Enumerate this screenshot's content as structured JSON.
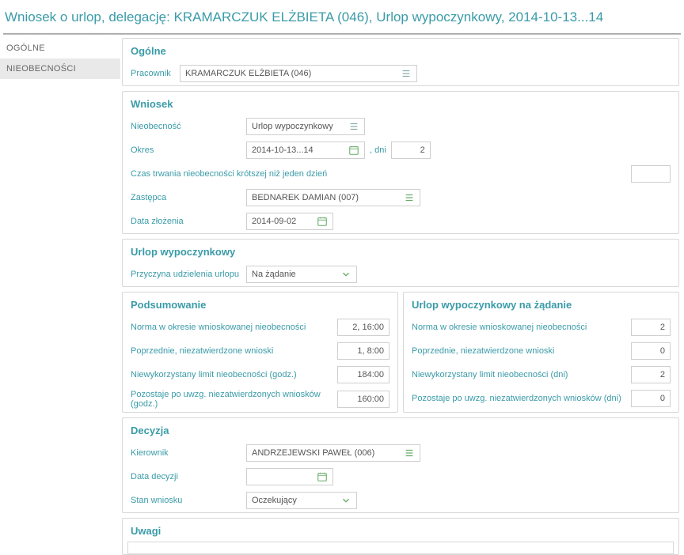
{
  "title": "Wniosek o urlop, delegację: KRAMARCZUK ELŻBIETA (046), Urlop wypoczynkowy, 2014-10-13...14",
  "sidebar": {
    "items": [
      {
        "label": "OGÓLNE"
      },
      {
        "label": "NIEOBECNOŚCI"
      }
    ]
  },
  "general": {
    "heading": "Ogólne",
    "emp_label": "Pracownik",
    "emp_value": "KRAMARCZUK ELŻBIETA (046)"
  },
  "request": {
    "heading": "Wniosek",
    "abs_label": "Nieobecność",
    "abs_value": "Urlop wypoczynkowy",
    "period_label": "Okres",
    "period_value": "2014-10-13...14",
    "days_label": ", dni",
    "days_value": "2",
    "short_label": "Czas trwania nieobecności krótszej niż jeden dzień",
    "short_value": "",
    "sub_label": "Zastępca",
    "sub_value": "BEDNAREK DAMIAN (007)",
    "date_label": "Data złożenia",
    "date_value": "2014-09-02"
  },
  "leave": {
    "heading": "Urlop wypoczynkowy",
    "reason_label": "Przyczyna udzielenia urlopu",
    "reason_value": "Na żądanie"
  },
  "summaryL": {
    "heading": "Podsumowanie",
    "r1": "Norma w okresie wnioskowanej nieobecności",
    "v1": "2, 16:00",
    "r2": "Poprzednie, niezatwierdzone wnioski",
    "v2": "1, 8:00",
    "r3": "Niewykorzystany limit nieobecności (godz.)",
    "v3": "184:00",
    "r4": "Pozostaje po uwzg. niezatwierdzonych wniosków (godz.)",
    "v4": "160:00"
  },
  "summaryR": {
    "heading": "Urlop wypoczynkowy na żądanie",
    "r1": "Norma w okresie wnioskowanej nieobecności",
    "v1": "2",
    "r2": "Poprzednie, niezatwierdzone wnioski",
    "v2": "0",
    "r3": "Niewykorzystany limit nieobecności (dni)",
    "v3": "2",
    "r4": "Pozostaje po uwzg. niezatwierdzonych wniosków (dni)",
    "v4": "0"
  },
  "decision": {
    "heading": "Decyzja",
    "mgr_label": "Kierownik",
    "mgr_value": "ANDRZEJEWSKI PAWEŁ (006)",
    "date_label": "Data decyzji",
    "date_value": "",
    "status_label": "Stan wniosku",
    "status_value": "Oczekujący"
  },
  "notes": {
    "heading": "Uwagi"
  }
}
